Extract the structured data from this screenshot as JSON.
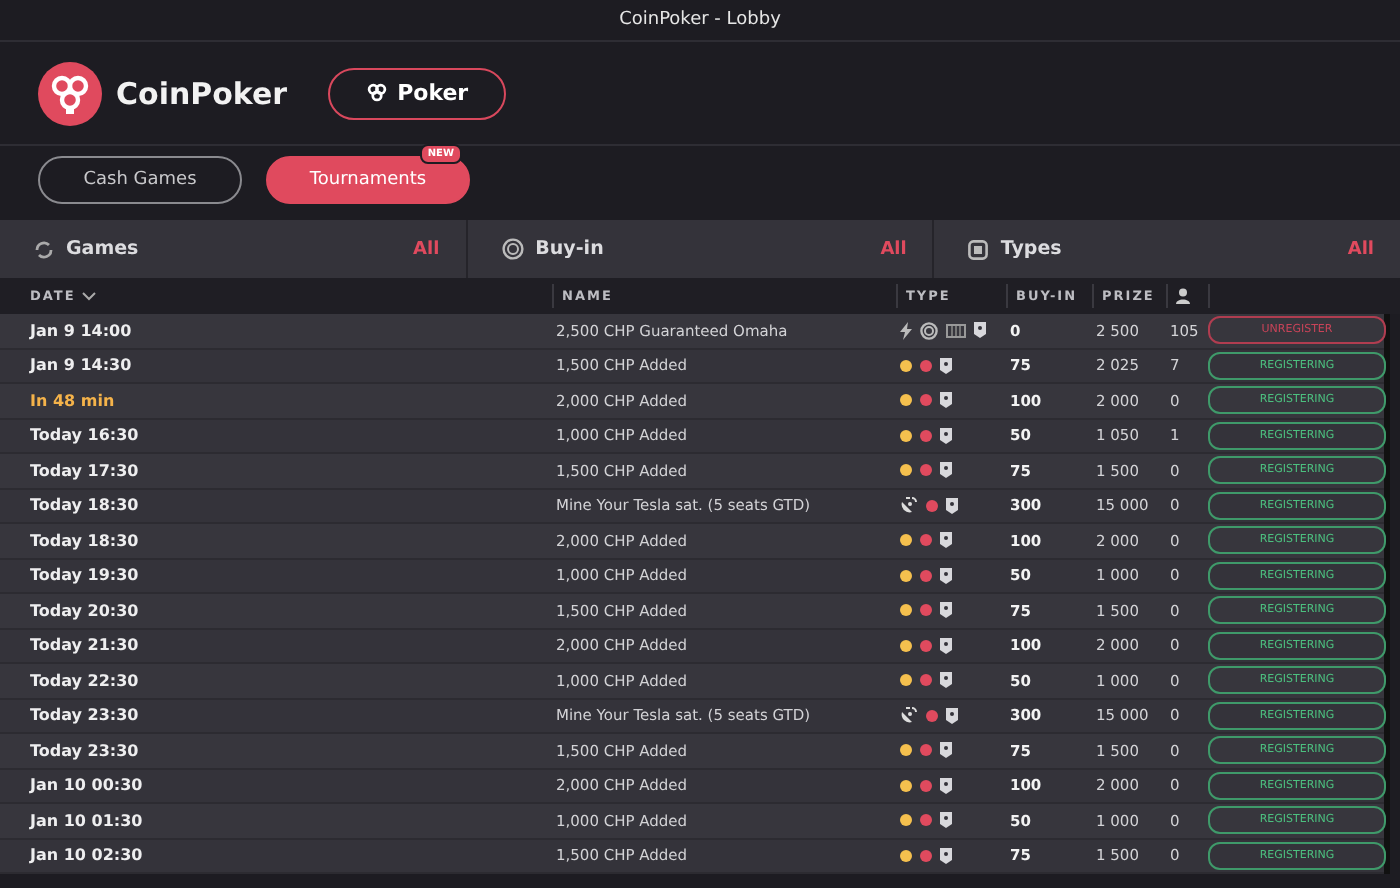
{
  "window": {
    "title": "CoinPoker - Lobby"
  },
  "brand": {
    "name": "CoinPoker"
  },
  "product_button": {
    "label": "Poker"
  },
  "tabs": [
    {
      "label": "Cash Games",
      "selected": false
    },
    {
      "label": "Tournaments",
      "selected": true,
      "badge": "NEW"
    }
  ],
  "filters": [
    {
      "kind": "games",
      "label": "Games",
      "value": "All"
    },
    {
      "kind": "buyin",
      "label": "Buy-in",
      "value": "All"
    },
    {
      "kind": "types",
      "label": "Types",
      "value": "All"
    }
  ],
  "table": {
    "columns": [
      "DATE",
      "NAME",
      "TYPE",
      "BUY-IN",
      "PRIZE"
    ],
    "rows": [
      {
        "date": "Jan 9 14:00",
        "soon": false,
        "name": "2,500 CHP Guaranteed Omaha",
        "kind": "special",
        "buyin": "0",
        "prize": "2 500",
        "players": "105",
        "action": {
          "kind": "unregister",
          "label": "UNREGISTER"
        }
      },
      {
        "date": "Jan 9 14:30",
        "soon": false,
        "name": "1,500 CHP Added",
        "kind": "standard",
        "buyin": "75",
        "prize": "2 025",
        "players": "7",
        "action": {
          "kind": "register",
          "label": "REGISTERING"
        }
      },
      {
        "date": "In 48 min",
        "soon": true,
        "name": "2,000 CHP Added",
        "kind": "standard",
        "buyin": "100",
        "prize": "2 000",
        "players": "0",
        "action": {
          "kind": "register",
          "label": "REGISTERING"
        }
      },
      {
        "date": "Today 16:30",
        "soon": false,
        "name": "1,000 CHP Added",
        "kind": "standard",
        "buyin": "50",
        "prize": "1 050",
        "players": "1",
        "action": {
          "kind": "register",
          "label": "REGISTERING"
        }
      },
      {
        "date": "Today 17:30",
        "soon": false,
        "name": "1,500 CHP Added",
        "kind": "standard",
        "buyin": "75",
        "prize": "1 500",
        "players": "0",
        "action": {
          "kind": "register",
          "label": "REGISTERING"
        }
      },
      {
        "date": "Today 18:30",
        "soon": false,
        "name": "Mine Your Tesla sat. (5 seats GTD)",
        "kind": "satellite",
        "buyin": "300",
        "prize": "15 000",
        "players": "0",
        "action": {
          "kind": "register",
          "label": "REGISTERING"
        }
      },
      {
        "date": "Today 18:30",
        "soon": false,
        "name": "2,000 CHP Added",
        "kind": "standard",
        "buyin": "100",
        "prize": "2 000",
        "players": "0",
        "action": {
          "kind": "register",
          "label": "REGISTERING"
        }
      },
      {
        "date": "Today 19:30",
        "soon": false,
        "name": "1,000 CHP Added",
        "kind": "standard",
        "buyin": "50",
        "prize": "1 000",
        "players": "0",
        "action": {
          "kind": "register",
          "label": "REGISTERING"
        }
      },
      {
        "date": "Today 20:30",
        "soon": false,
        "name": "1,500 CHP Added",
        "kind": "standard",
        "buyin": "75",
        "prize": "1 500",
        "players": "0",
        "action": {
          "kind": "register",
          "label": "REGISTERING"
        }
      },
      {
        "date": "Today 21:30",
        "soon": false,
        "name": "2,000 CHP Added",
        "kind": "standard",
        "buyin": "100",
        "prize": "2 000",
        "players": "0",
        "action": {
          "kind": "register",
          "label": "REGISTERING"
        }
      },
      {
        "date": "Today 22:30",
        "soon": false,
        "name": "1,000 CHP Added",
        "kind": "standard",
        "buyin": "50",
        "prize": "1 000",
        "players": "0",
        "action": {
          "kind": "register",
          "label": "REGISTERING"
        }
      },
      {
        "date": "Today 23:30",
        "soon": false,
        "name": "Mine Your Tesla sat. (5 seats GTD)",
        "kind": "satellite",
        "buyin": "300",
        "prize": "15 000",
        "players": "0",
        "action": {
          "kind": "register",
          "label": "REGISTERING"
        }
      },
      {
        "date": "Today 23:30",
        "soon": false,
        "name": "1,500 CHP Added",
        "kind": "standard",
        "buyin": "75",
        "prize": "1 500",
        "players": "0",
        "action": {
          "kind": "register",
          "label": "REGISTERING"
        }
      },
      {
        "date": "Jan 10 00:30",
        "soon": false,
        "name": "2,000 CHP Added",
        "kind": "standard",
        "buyin": "100",
        "prize": "2 000",
        "players": "0",
        "action": {
          "kind": "register",
          "label": "REGISTERING"
        }
      },
      {
        "date": "Jan 10 01:30",
        "soon": false,
        "name": "1,000 CHP Added",
        "kind": "standard",
        "buyin": "50",
        "prize": "1 000",
        "players": "0",
        "action": {
          "kind": "register",
          "label": "REGISTERING"
        }
      },
      {
        "date": "Jan 10 02:30",
        "soon": false,
        "name": "1,500 CHP Added",
        "kind": "standard",
        "buyin": "75",
        "prize": "1 500",
        "players": "0",
        "action": {
          "kind": "register",
          "label": "REGISTERING"
        }
      }
    ]
  }
}
